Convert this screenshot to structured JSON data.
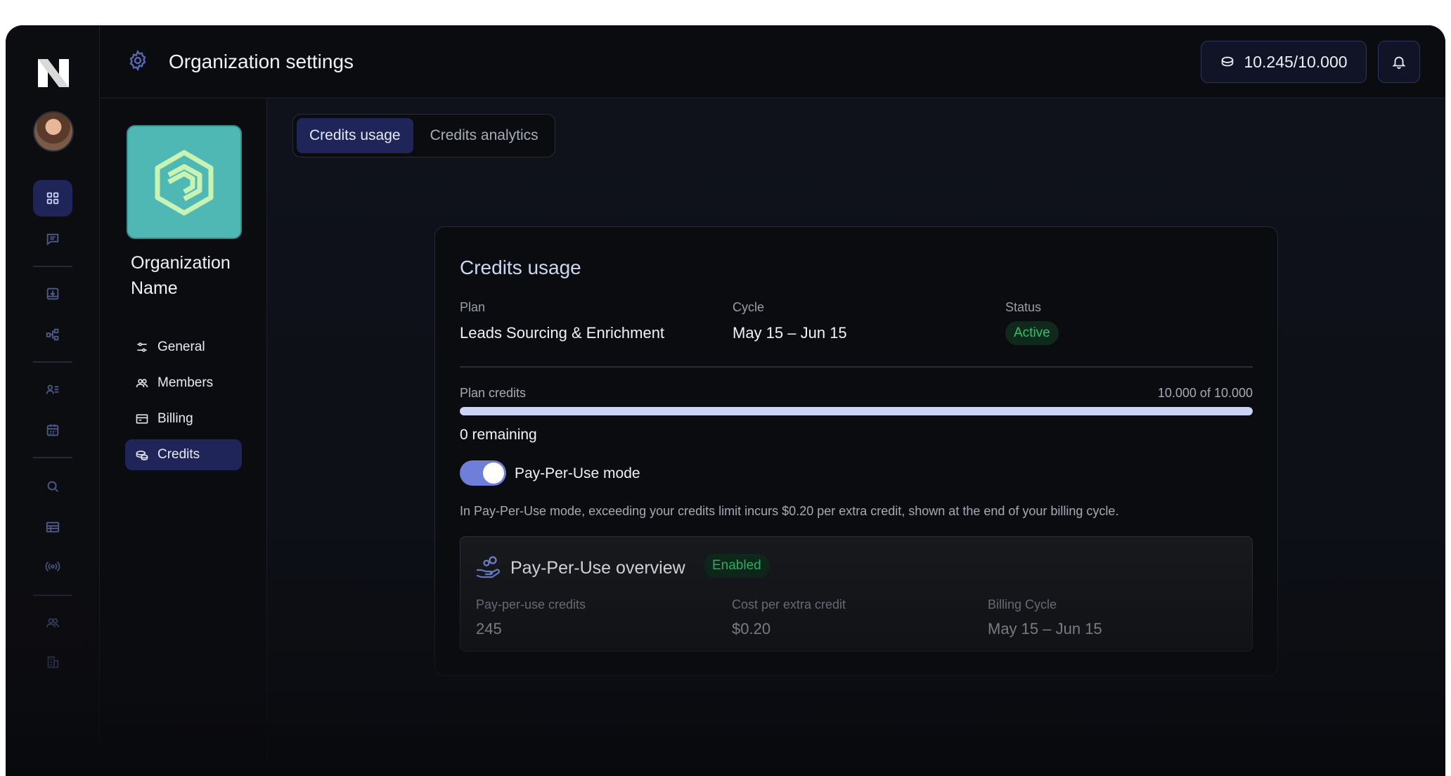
{
  "header": {
    "title": "Organization settings",
    "credits_balance": "10.245/10.000"
  },
  "org": {
    "name": "Organization Name",
    "nav": [
      {
        "label": "General",
        "icon": "sliders-icon"
      },
      {
        "label": "Members",
        "icon": "users-icon"
      },
      {
        "label": "Billing",
        "icon": "billing-icon"
      },
      {
        "label": "Credits",
        "icon": "coins-icon",
        "active": true
      }
    ]
  },
  "tabs": [
    {
      "label": "Credits usage",
      "active": true
    },
    {
      "label": "Credits analytics",
      "active": false
    }
  ],
  "card": {
    "title": "Credits usage",
    "plan_label": "Plan",
    "plan_value": "Leads Sourcing & Enrichment",
    "cycle_label": "Cycle",
    "cycle_value": "May 15 – Jun 15",
    "status_label": "Status",
    "status_value": "Active",
    "plan_credits_label": "Plan credits",
    "plan_credits_count": "10.000 of 10.000",
    "plan_credits_used_fraction": 1.0,
    "remaining": "0 remaining",
    "toggle_on": true,
    "toggle_label": "Pay-Per-Use mode",
    "note": "In Pay-Per-Use mode, exceeding your credits limit incurs $0.20 per extra credit, shown at the end of your billing cycle."
  },
  "ppu": {
    "title": "Pay-Per-Use overview",
    "badge": "Enabled",
    "credits_label": "Pay-per-use credits",
    "credits_value": "245",
    "cost_label": "Cost per extra credit",
    "cost_value": "$0.20",
    "cycle_label": "Billing Cycle",
    "cycle_value": "May 15 – Jun 15"
  },
  "colors": {
    "accent": "#1f2559",
    "toggle": "#6f7fd9",
    "success": "#34c16d",
    "org_logo_bg": "#4fb8b4"
  }
}
